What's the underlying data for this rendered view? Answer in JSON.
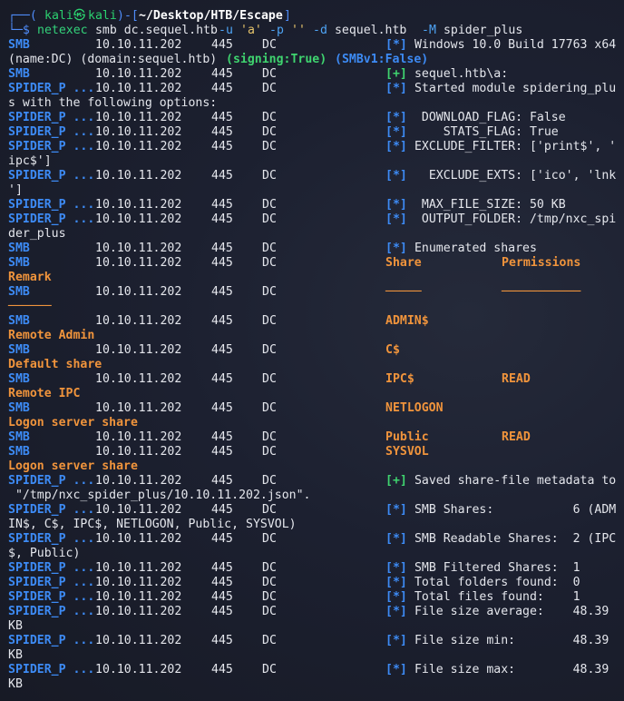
{
  "prompt": {
    "user": "kali",
    "at": "㉿",
    "host": "kali",
    "path": "~/Desktop/HTB/Escape",
    "command": "netexec",
    "command_args_1": " smb dc.sequel.htb ",
    "flag_u": "-u",
    "val_u": "'a'",
    "flag_p": "-p",
    "val_p": "''",
    "flag_d": "-d",
    "val_d": " sequel.htb ",
    "flag_M": "-M",
    "val_M": " spider_plus"
  },
  "lines": [
    {
      "proto": "SMB",
      "ip": "10.10.11.202",
      "port": "445",
      "host": "DC",
      "marker": "[*]",
      "text": " Windows 10.0 Build 17763 x64"
    },
    {
      "cont": "(name:DC) (domain:sequel.htb) ",
      "signing_label": "(signing:True)",
      "smb_label": "(SMBv1:False)"
    },
    {
      "proto": "SMB",
      "ip": "10.10.11.202",
      "port": "445",
      "host": "DC",
      "marker": "[+]",
      "text": " sequel.htb\\a:",
      "marker_color": "green"
    },
    {
      "proto": "SPIDER_P ...",
      "ip": "10.10.11.202",
      "port": "445",
      "host": "DC",
      "marker": "[*]",
      "text": " Started module spidering_plu"
    },
    {
      "cont": "s with the following options:"
    },
    {
      "proto": "SPIDER_P ...",
      "ip": "10.10.11.202",
      "port": "445",
      "host": "DC",
      "marker": "[*]",
      "text": "  DOWNLOAD_FLAG: False"
    },
    {
      "proto": "SPIDER_P ...",
      "ip": "10.10.11.202",
      "port": "445",
      "host": "DC",
      "marker": "[*]",
      "text": "     STATS_FLAG: True"
    },
    {
      "proto": "SPIDER_P ...",
      "ip": "10.10.11.202",
      "port": "445",
      "host": "DC",
      "marker": "[*]",
      "text": " EXCLUDE_FILTER: ['print$', '"
    },
    {
      "cont": "ipc$']"
    },
    {
      "proto": "SPIDER_P ...",
      "ip": "10.10.11.202",
      "port": "445",
      "host": "DC",
      "marker": "[*]",
      "text": "   EXCLUDE_EXTS: ['ico', 'lnk"
    },
    {
      "cont": "']"
    },
    {
      "proto": "SPIDER_P ...",
      "ip": "10.10.11.202",
      "port": "445",
      "host": "DC",
      "marker": "[*]",
      "text": "  MAX_FILE_SIZE: 50 KB"
    },
    {
      "proto": "SPIDER_P ...",
      "ip": "10.10.11.202",
      "port": "445",
      "host": "DC",
      "marker": "[*]",
      "text": "  OUTPUT_FOLDER: /tmp/nxc_spi"
    },
    {
      "cont": "der_plus"
    },
    {
      "proto": "SMB",
      "ip": "10.10.11.202",
      "port": "445",
      "host": "DC",
      "marker": "[*]",
      "text": " Enumerated shares"
    },
    {
      "proto": "SMB",
      "ip": "10.10.11.202",
      "port": "445",
      "host": "DC",
      "share": "Share",
      "perm": "Permissions"
    },
    {
      "orange_cont": "Remark"
    },
    {
      "proto": "SMB",
      "ip": "10.10.11.202",
      "port": "445",
      "host": "DC",
      "share": "─────",
      "perm": "───────────"
    },
    {
      "orange_cont": "──────"
    },
    {
      "proto": "SMB",
      "ip": "10.10.11.202",
      "port": "445",
      "host": "DC",
      "share": "ADMIN$",
      "perm": ""
    },
    {
      "orange_cont": "Remote Admin"
    },
    {
      "proto": "SMB",
      "ip": "10.10.11.202",
      "port": "445",
      "host": "DC",
      "share": "C$",
      "perm": ""
    },
    {
      "orange_cont": "Default share"
    },
    {
      "proto": "SMB",
      "ip": "10.10.11.202",
      "port": "445",
      "host": "DC",
      "share": "IPC$",
      "perm": "READ"
    },
    {
      "orange_cont": "Remote IPC"
    },
    {
      "proto": "SMB",
      "ip": "10.10.11.202",
      "port": "445",
      "host": "DC",
      "share": "NETLOGON",
      "perm": ""
    },
    {
      "orange_cont": "Logon server share"
    },
    {
      "proto": "SMB",
      "ip": "10.10.11.202",
      "port": "445",
      "host": "DC",
      "share": "Public",
      "perm": "READ"
    },
    {
      "proto": "SMB",
      "ip": "10.10.11.202",
      "port": "445",
      "host": "DC",
      "share": "SYSVOL",
      "perm": ""
    },
    {
      "orange_cont": "Logon server share"
    },
    {
      "proto": "SPIDER_P ...",
      "ip": "10.10.11.202",
      "port": "445",
      "host": "DC",
      "marker": "[+]",
      "text": " Saved share-file metadata to",
      "marker_color": "green"
    },
    {
      "cont": " \"/tmp/nxc_spider_plus/10.10.11.202.json\"."
    },
    {
      "proto": "SPIDER_P ...",
      "ip": "10.10.11.202",
      "port": "445",
      "host": "DC",
      "marker": "[*]",
      "text": " SMB Shares:           6 (ADM"
    },
    {
      "cont": "IN$, C$, IPC$, NETLOGON, Public, SYSVOL)"
    },
    {
      "proto": "SPIDER_P ...",
      "ip": "10.10.11.202",
      "port": "445",
      "host": "DC",
      "marker": "[*]",
      "text": " SMB Readable Shares:  2 (IPC"
    },
    {
      "cont": "$, Public)"
    },
    {
      "proto": "SPIDER_P ...",
      "ip": "10.10.11.202",
      "port": "445",
      "host": "DC",
      "marker": "[*]",
      "text": " SMB Filtered Shares:  1"
    },
    {
      "proto": "SPIDER_P ...",
      "ip": "10.10.11.202",
      "port": "445",
      "host": "DC",
      "marker": "[*]",
      "text": " Total folders found:  0"
    },
    {
      "proto": "SPIDER_P ...",
      "ip": "10.10.11.202",
      "port": "445",
      "host": "DC",
      "marker": "[*]",
      "text": " Total files found:    1"
    },
    {
      "proto": "SPIDER_P ...",
      "ip": "10.10.11.202",
      "port": "445",
      "host": "DC",
      "marker": "[*]",
      "text": " File size average:    48.39"
    },
    {
      "cont": "KB"
    },
    {
      "proto": "SPIDER_P ...",
      "ip": "10.10.11.202",
      "port": "445",
      "host": "DC",
      "marker": "[*]",
      "text": " File size min:        48.39"
    },
    {
      "cont": "KB"
    },
    {
      "proto": "SPIDER_P ...",
      "ip": "10.10.11.202",
      "port": "445",
      "host": "DC",
      "marker": "[*]",
      "text": " File size max:        48.39"
    },
    {
      "cont": "KB"
    }
  ],
  "colors": {
    "background": "#1a1d29",
    "proto_blue": "#3d8bf5",
    "success_green": "#3fd46f",
    "share_orange": "#f0943c",
    "info_blue": "#3d8bf5"
  }
}
